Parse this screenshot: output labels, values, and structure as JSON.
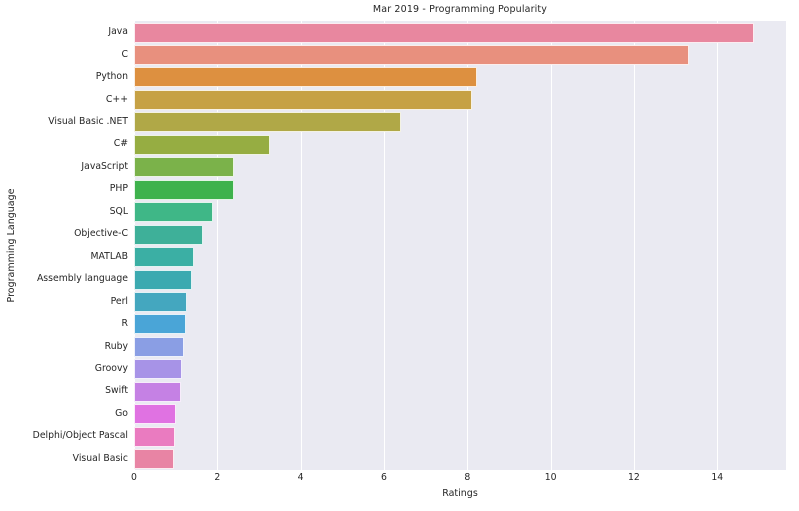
{
  "chart_data": {
    "type": "bar",
    "orientation": "horizontal",
    "title": "Mar 2019 - Programming Popularity",
    "xlabel": "Ratings",
    "ylabel": "Programming Language",
    "xlim": [
      0,
      15.65
    ],
    "xticks": [
      0,
      2,
      4,
      6,
      8,
      10,
      12,
      14
    ],
    "xticklabels": [
      "0",
      "2",
      "4",
      "6",
      "8",
      "10",
      "12",
      "14"
    ],
    "grid": true,
    "grid_axis": "x",
    "legend": null,
    "categories": [
      "Java",
      "C",
      "Python",
      "C++",
      "Visual Basic .NET",
      "C#",
      "JavaScript",
      "PHP",
      "SQL",
      "Objective-C",
      "MATLAB",
      "Assembly language",
      "Perl",
      "R",
      "Ruby",
      "Groovy",
      "Swift",
      "Go",
      "Delphi/Object Pascal",
      "Visual Basic"
    ],
    "values": [
      14.88,
      13.31,
      8.24,
      8.12,
      6.42,
      3.27,
      2.4,
      2.4,
      1.9,
      1.66,
      1.44,
      1.4,
      1.28,
      1.24,
      1.19,
      1.16,
      1.14,
      1.02,
      0.99,
      0.95
    ],
    "colors": [
      "#e8879f",
      "#e8907e",
      "#dd9040",
      "#c6a144",
      "#b0a847",
      "#96ad42",
      "#7bb24a",
      "#3eb24c",
      "#3fb787",
      "#3eb099",
      "#3bafa4",
      "#3caab0",
      "#44a7bf",
      "#4aa5d7",
      "#8a9ee4",
      "#a793e7",
      "#c581e4",
      "#e072e2",
      "#ea7bc0",
      "#e884a4"
    ],
    "plot_bg": "#eaeaf2",
    "grid_color": "#ffffff",
    "figure_bg": "#ffffff"
  }
}
